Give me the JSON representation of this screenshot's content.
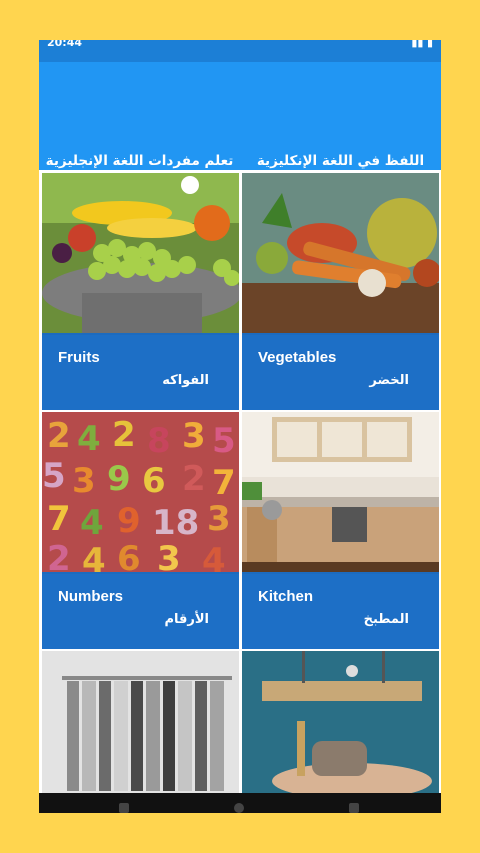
{
  "status_bar": {
    "time": "20:44",
    "right_icons": "signal-icon battery-icon"
  },
  "tabs": [
    {
      "label": "تعلم مفردات اللغة الإنجليزية",
      "selected": true
    },
    {
      "label": "اللفظ في اللغة الإنكليزية",
      "selected": false
    }
  ],
  "cards": [
    {
      "en": "Fruits",
      "ar": "الفواكه"
    },
    {
      "en": "Vegetables",
      "ar": "الخضر"
    },
    {
      "en": "Numbers",
      "ar": "الأرقام"
    },
    {
      "en": "Kitchen",
      "ar": "المطبخ"
    },
    {
      "en": "",
      "ar": ""
    },
    {
      "en": "",
      "ar": ""
    }
  ],
  "colors": {
    "background": "#FFD54F",
    "appbar": "#2196F3",
    "caption": "#1d6fc6"
  }
}
